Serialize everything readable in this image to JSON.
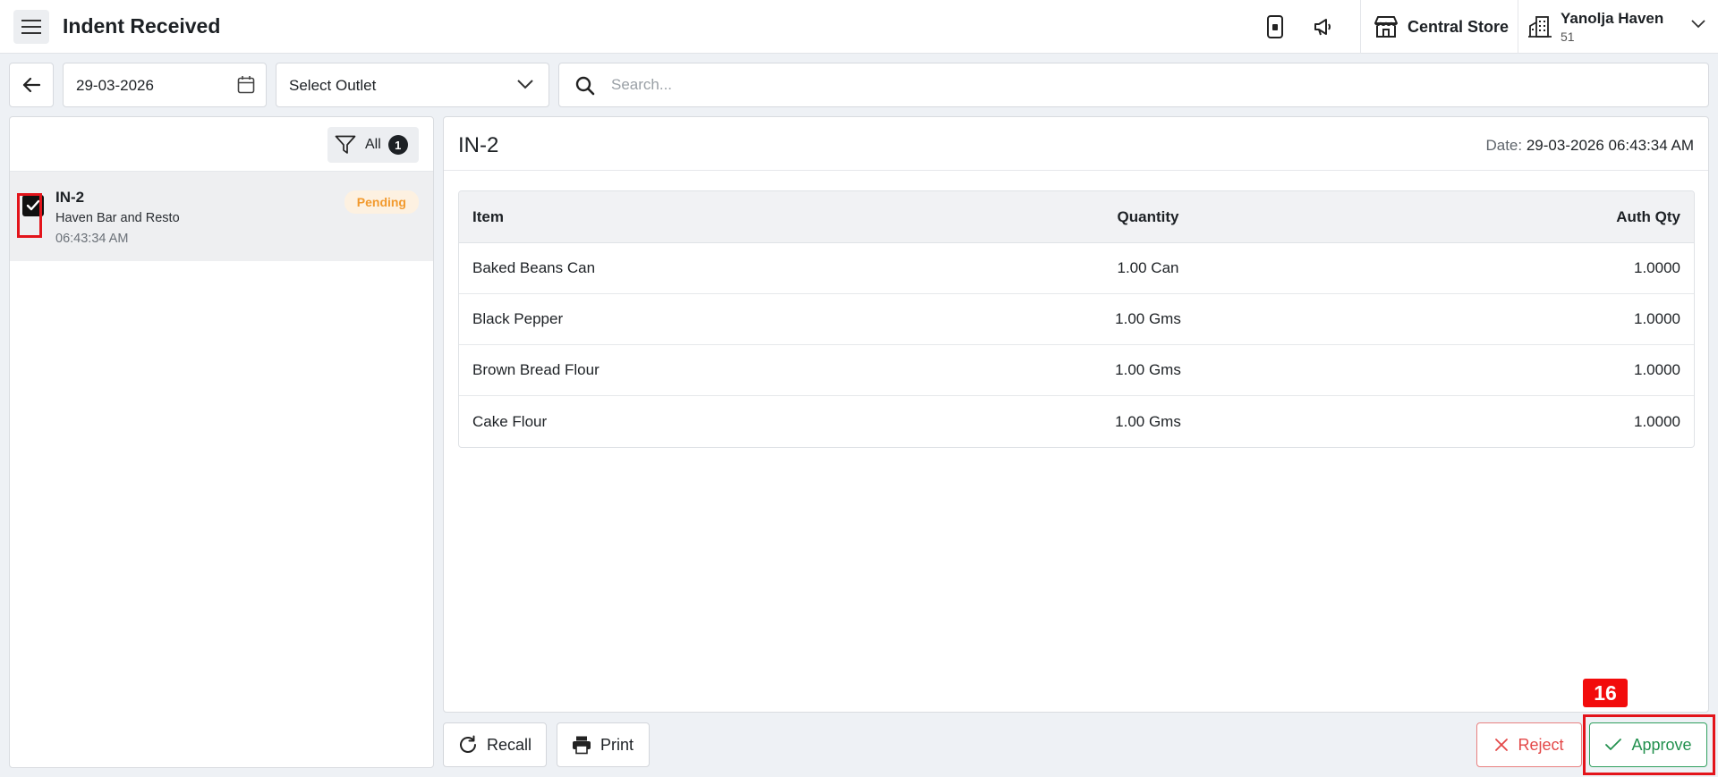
{
  "header": {
    "title": "Indent Received",
    "store_name": "Central Store",
    "property_name": "Yanolja Haven",
    "property_sub": "51"
  },
  "toolbar": {
    "date_value": "29-03-2026",
    "outlet_value": "Select Outlet",
    "search_placeholder": "Search..."
  },
  "list": {
    "filter_label": "All",
    "filter_count": "1",
    "items": [
      {
        "title": "IN-2",
        "subtitle": "Haven Bar and Resto",
        "time": "06:43:34 AM",
        "status": "Pending",
        "checked": true
      }
    ]
  },
  "detail": {
    "title": "IN-2",
    "date_label": "Date:",
    "date_value": "29-03-2026 06:43:34 AM",
    "columns": [
      "Item",
      "Quantity",
      "Auth Qty"
    ],
    "rows": [
      {
        "item": "Baked Beans Can",
        "quantity": "1.00 Can",
        "auth_qty": "1.0000"
      },
      {
        "item": "Black Pepper",
        "quantity": "1.00 Gms",
        "auth_qty": "1.0000"
      },
      {
        "item": "Brown Bread Flour",
        "quantity": "1.00 Gms",
        "auth_qty": "1.0000"
      },
      {
        "item": "Cake Flour",
        "quantity": "1.00 Gms",
        "auth_qty": "1.0000"
      }
    ]
  },
  "actions": {
    "recall_label": "Recall",
    "print_label": "Print",
    "reject_label": "Reject",
    "approve_label": "Approve"
  },
  "annotation": {
    "step_number": "16"
  },
  "colors": {
    "pending": "#f29a2e",
    "reject": "#e34848",
    "approve": "#23914f",
    "highlight": "#e3141b"
  }
}
